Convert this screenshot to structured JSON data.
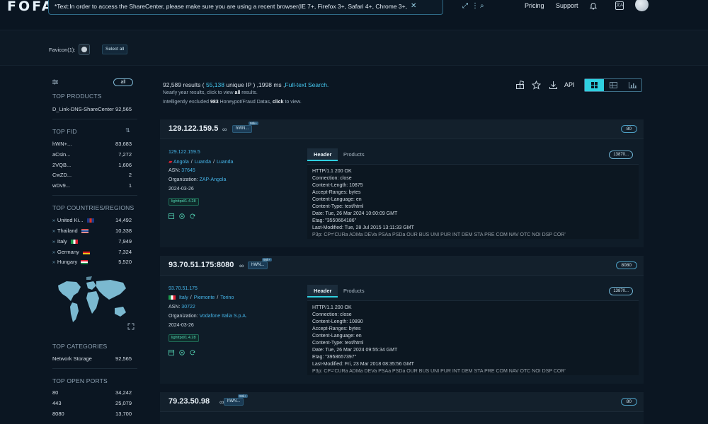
{
  "header": {
    "logo": "FOFA",
    "query": "*Text:In order to access the ShareCenter, please make sure you are using a recent browser(IE 7+, Firefox 3+, Safari 4+, Chrome 3+, O",
    "nav": [
      "Pricing",
      "Support"
    ],
    "translate_icon": "translate-icon",
    "bell_icon": "bell-icon"
  },
  "favicon_bar": {
    "label": "Favicon(1):",
    "select_all": "Select all"
  },
  "sidebar": {
    "all_label": "all",
    "top_products": {
      "title": "TOP PRODUCTS",
      "items": [
        {
          "name": "D_Link-DNS-ShareCenter",
          "count": "92,565"
        }
      ]
    },
    "top_fid": {
      "title": "TOP FID",
      "items": [
        {
          "name": "hWN+...",
          "count": "83,683"
        },
        {
          "name": "aCsin...",
          "count": "7,272"
        },
        {
          "name": "2VQB...",
          "count": "1,606"
        },
        {
          "name": "CwZD...",
          "count": "2"
        },
        {
          "name": "wDv9...",
          "count": "1"
        }
      ]
    },
    "top_countries": {
      "title": "TOP COUNTRIES/REGIONS",
      "items": [
        {
          "name": "United Ki...",
          "count": "14,492",
          "flag": "uk"
        },
        {
          "name": "Thailand",
          "count": "10,338",
          "flag": "th"
        },
        {
          "name": "Italy",
          "count": "7,949",
          "flag": "it"
        },
        {
          "name": "Germany",
          "count": "7,324",
          "flag": "de"
        },
        {
          "name": "Hungary",
          "count": "5,520",
          "flag": "hu"
        }
      ]
    },
    "top_categories": {
      "title": "TOP CATEGORIES",
      "items": [
        {
          "name": "Network Storage",
          "count": "92,565"
        }
      ]
    },
    "top_ports": {
      "title": "TOP OPEN PORTS",
      "items": [
        {
          "name": "80",
          "count": "34,242"
        },
        {
          "name": "443",
          "count": "25,079"
        },
        {
          "name": "8080",
          "count": "13,700"
        }
      ]
    }
  },
  "results": {
    "total": "92,589",
    "results_word": "results (",
    "unique_ip": "55,138",
    "unique_word": "unique IP ) ,",
    "time": "1998",
    "ms_word": "ms ,",
    "mode": "Full-text Search.",
    "line2_a": "Nearly year results, click to view",
    "line2_b": "all",
    "line2_c": "results.",
    "line3_a": "Intelligently excluded",
    "line3_b": "983",
    "line3_c": "Honeypot/Fraud Datas,",
    "line3_d": "click",
    "line3_e": "to view.",
    "api_label": "API"
  },
  "cards": [
    {
      "host": "129.122.159.5",
      "hwn": "hWN...",
      "hwn_badge": "98k+",
      "port": "80",
      "ip": "129.122.159.5",
      "country": "Angola",
      "region": "Luanda",
      "city": "Luanda",
      "asn_label": "ASN:",
      "asn": "37645",
      "org_label": "Organization:",
      "org": "ZAP-Angola",
      "date": "2024-03-26",
      "tag": "lighttpd/1.4.28",
      "tab_header": "Header",
      "tab_products": "Products",
      "size": "13870...",
      "banner": [
        "HTTP/1.1 200 OK",
        "Connection: close",
        "Content-Length: 10875",
        "Accept-Ranges: bytes",
        "Content-Language: en",
        "Content-Type: text/html",
        "Date: Tue, 26 Mar 2024 10:00:09 GMT",
        "Etag: \"3550664186\"",
        "Last-Modified: Tue, 28 Jul 2015 13:11:33 GMT",
        "P3p: CP='CURa ADMa DEVa PSAa PSDa OUR BUS UNI PUR INT DEM STA PRE COM NAV OTC NOI DSP COR'"
      ]
    },
    {
      "host": "93.70.51.175:8080",
      "hwn": "hWN...",
      "hwn_badge": "98k+",
      "port": "8080",
      "ip": "93.70.51.175",
      "country": "Italy",
      "region": "Piemonte",
      "city": "Torino",
      "asn_label": "ASN:",
      "asn": "30722",
      "org_label": "Organization:",
      "org": "Vodafone Italia S.p.A.",
      "date": "2024-03-26",
      "tag": "lighttpd/1.4.28",
      "tab_header": "Header",
      "tab_products": "Products",
      "size": "13870...",
      "banner": [
        "HTTP/1.1 200 OK",
        "Connection: close",
        "Content-Length: 10890",
        "Accept-Ranges: bytes",
        "Content-Language: en",
        "Content-Type: text/html",
        "Date: Tue, 26 Mar 2024 09:55:34 GMT",
        "Etag: \"3958657397\"",
        "Last-Modified: Fri, 23 Mar 2018 08:35:56 GMT",
        "P3p: CP='CURa ADMa DEVa PSAa PSDa OUR BUS UNI PUR INT DEM STA PRE COM NAV OTC NOI DSP COR'"
      ]
    },
    {
      "host": "79.23.50.98",
      "hwn": "hWN...",
      "hwn_badge": "98k+",
      "port": "80"
    }
  ],
  "colors": {
    "accent": "#2fd0e0",
    "link": "#45b3e6",
    "background": "#0b1622"
  }
}
